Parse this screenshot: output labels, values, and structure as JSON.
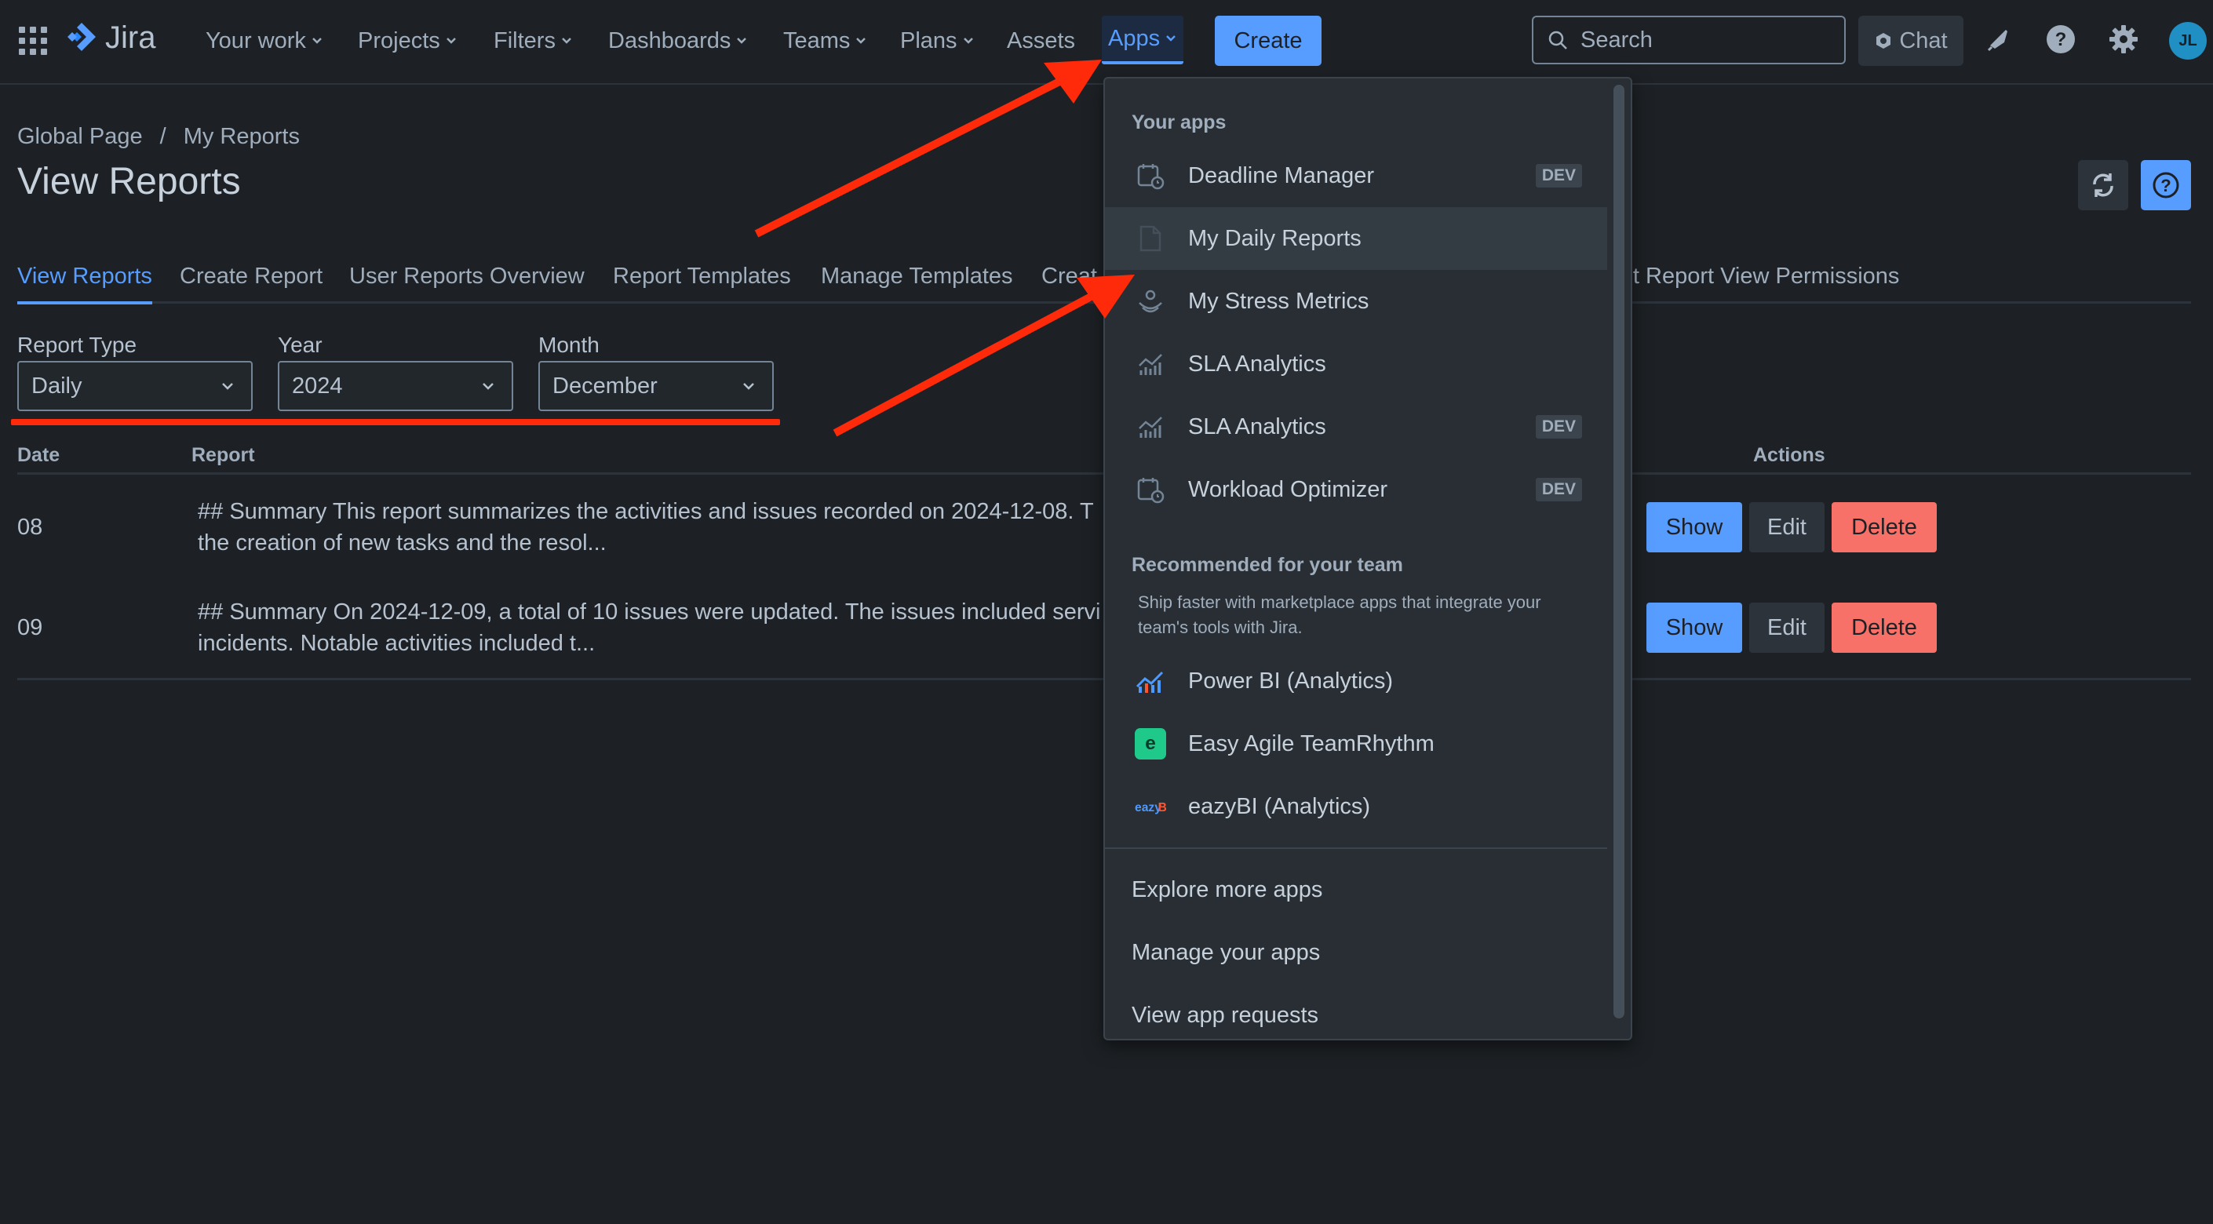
{
  "nav": {
    "logo": "Jira",
    "items": [
      {
        "label": "Your work",
        "chevron": true
      },
      {
        "label": "Projects",
        "chevron": true
      },
      {
        "label": "Filters",
        "chevron": true
      },
      {
        "label": "Dashboards",
        "chevron": true
      },
      {
        "label": "Teams",
        "chevron": true
      },
      {
        "label": "Plans",
        "chevron": true
      },
      {
        "label": "Assets",
        "chevron": false
      },
      {
        "label": "Apps",
        "chevron": true,
        "active": true
      }
    ],
    "create_label": "Create",
    "search_placeholder": "Search",
    "chat_label": "Chat",
    "avatar_initials": "JL"
  },
  "breadcrumb": {
    "items": [
      "Global Page",
      "My Reports"
    ],
    "separator": "/"
  },
  "page": {
    "title": "View Reports"
  },
  "tabs": [
    {
      "label": "View Reports",
      "active": true
    },
    {
      "label": "Create Report"
    },
    {
      "label": "User Reports Overview"
    },
    {
      "label": "Report Templates"
    },
    {
      "label": "Manage Templates"
    },
    {
      "label": "Creat"
    },
    {
      "label": "lit Report View Permissions"
    }
  ],
  "filters": {
    "report_type": {
      "label": "Report Type",
      "value": "Daily"
    },
    "year": {
      "label": "Year",
      "value": "2024"
    },
    "month": {
      "label": "Month",
      "value": "December"
    }
  },
  "table": {
    "headers": {
      "date": "Date",
      "report": "Report",
      "actions": "Actions"
    },
    "rows": [
      {
        "date": "08",
        "report_line1": "## Summary This report summarizes the activities and issues recorded on 2024-12-08. T",
        "report_line2": "the creation of new tasks and the resol..."
      },
      {
        "date": "09",
        "report_line1": "## Summary On 2024-12-09, a total of 10 issues were updated. The issues included servi",
        "report_line2": "incidents. Notable activities included t..."
      }
    ],
    "actions": {
      "show": "Show",
      "edit": "Edit",
      "delete": "Delete"
    }
  },
  "apps_menu": {
    "your_apps_heading": "Your apps",
    "your_apps": [
      {
        "label": "Deadline Manager",
        "icon": "calendar-clock-icon",
        "badge": "DEV"
      },
      {
        "label": "My Daily Reports",
        "icon": "document-icon",
        "badge": ""
      },
      {
        "label": "My Stress Metrics",
        "icon": "gauge-icon",
        "badge": ""
      },
      {
        "label": "SLA Analytics",
        "icon": "chart-icon",
        "badge": ""
      },
      {
        "label": "SLA Analytics",
        "icon": "chart-icon",
        "badge": "DEV"
      },
      {
        "label": "Workload Optimizer",
        "icon": "calendar-clock-icon",
        "badge": "DEV"
      }
    ],
    "recommended_heading": "Recommended for your team",
    "recommended_desc": "Ship faster with marketplace apps that integrate your team's tools with Jira.",
    "recommended": [
      {
        "label": "Power BI (Analytics)",
        "icon": "powerbi-icon"
      },
      {
        "label": "Easy Agile TeamRhythm",
        "icon": "easy-agile-icon"
      },
      {
        "label": "eazyBI (Analytics)",
        "icon": "eazybi-icon"
      }
    ],
    "footer": [
      "Explore more apps",
      "Manage your apps",
      "View app requests"
    ]
  },
  "colors": {
    "accent": "#579dff",
    "danger": "#f87168",
    "annotation": "#ff2a0a",
    "background": "#1d2125"
  }
}
